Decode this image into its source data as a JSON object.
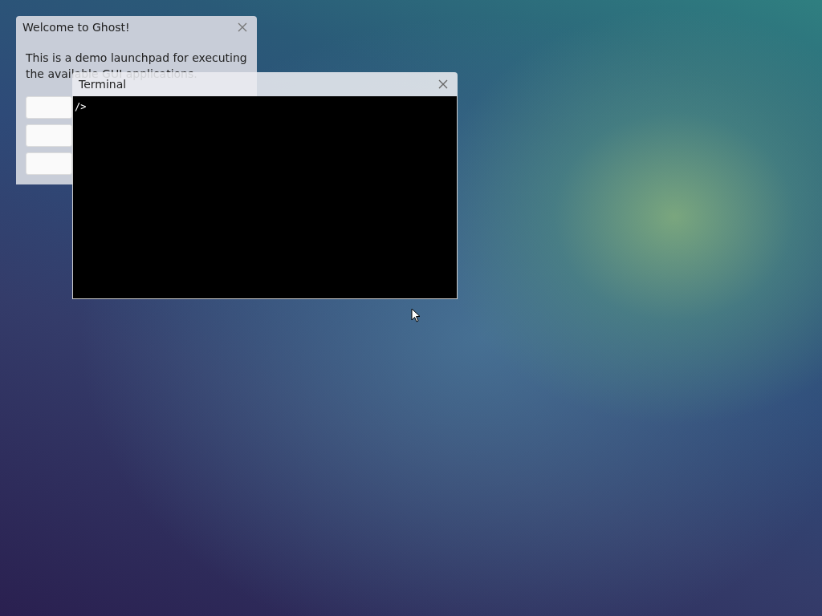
{
  "windows": [
    {
      "kind": "launchpad",
      "title": "Welcome to Ghost!",
      "text": "This is a demo launchpad for executing the available GUI applications.",
      "buttons": [
        {
          "kind": "launch"
        },
        {
          "kind": "launch"
        },
        {
          "kind": "launch"
        }
      ]
    },
    {
      "kind": "terminal",
      "title": "Terminal",
      "prompt": "/>"
    }
  ]
}
